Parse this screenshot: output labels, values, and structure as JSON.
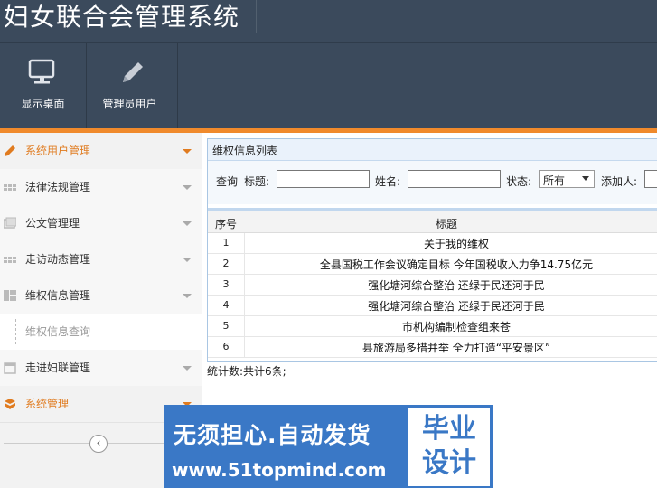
{
  "app": {
    "title": "妇女联合会管理系统"
  },
  "toolbar": [
    {
      "label": "显示桌面",
      "icon": "monitor-icon"
    },
    {
      "label": "管理员用户",
      "icon": "pencil-icon"
    }
  ],
  "sidebar": {
    "items": [
      {
        "label": "系统用户管理",
        "icon": "pencil-icon",
        "active": true
      },
      {
        "label": "法律法规管理",
        "icon": "grid-icon"
      },
      {
        "label": "公文管理理",
        "icon": "document-icon"
      },
      {
        "label": "走访动态管理",
        "icon": "grid-icon"
      },
      {
        "label": "维权信息管理",
        "icon": "layout-icon"
      },
      {
        "label": "维权信息查询",
        "sub": true
      },
      {
        "label": "走进妇联管理",
        "icon": "calendar-icon"
      },
      {
        "label": "系统管理",
        "icon": "box-icon",
        "active": true
      }
    ],
    "collapse_symbol": "‹"
  },
  "panel": {
    "title": "维权信息列表",
    "search": {
      "query_label": "查询",
      "title_label": "标题:",
      "title_value": "",
      "name_label": "姓名:",
      "name_value": "",
      "status_label": "状态:",
      "status_value": "所有",
      "adder_label": "添加人:"
    },
    "table": {
      "headers": [
        "序号",
        "标题"
      ],
      "rows": [
        [
          "1",
          "关于我的维权"
        ],
        [
          "2",
          "全县国税工作会议确定目标 今年国税收入力争14.75亿元"
        ],
        [
          "3",
          "强化塘河综合整治 还绿于民还河于民"
        ],
        [
          "4",
          "强化塘河综合整治 还绿于民还河于民"
        ],
        [
          "5",
          "市机构编制检查组来苍"
        ],
        [
          "6",
          "县旅游局多措并举 全力打造“平安景区”"
        ]
      ]
    },
    "stats": "统计数:共计6条;"
  },
  "watermark": {
    "line1": "无须担心.自动发货",
    "line2": "www.51topmind.com",
    "box_line1": "毕业",
    "box_line2": "设计"
  },
  "colors": {
    "header": "#3b4a5c",
    "accent": "#f08a2c",
    "panel_border": "#a9c6e3",
    "watermark": "#3a78c6"
  }
}
